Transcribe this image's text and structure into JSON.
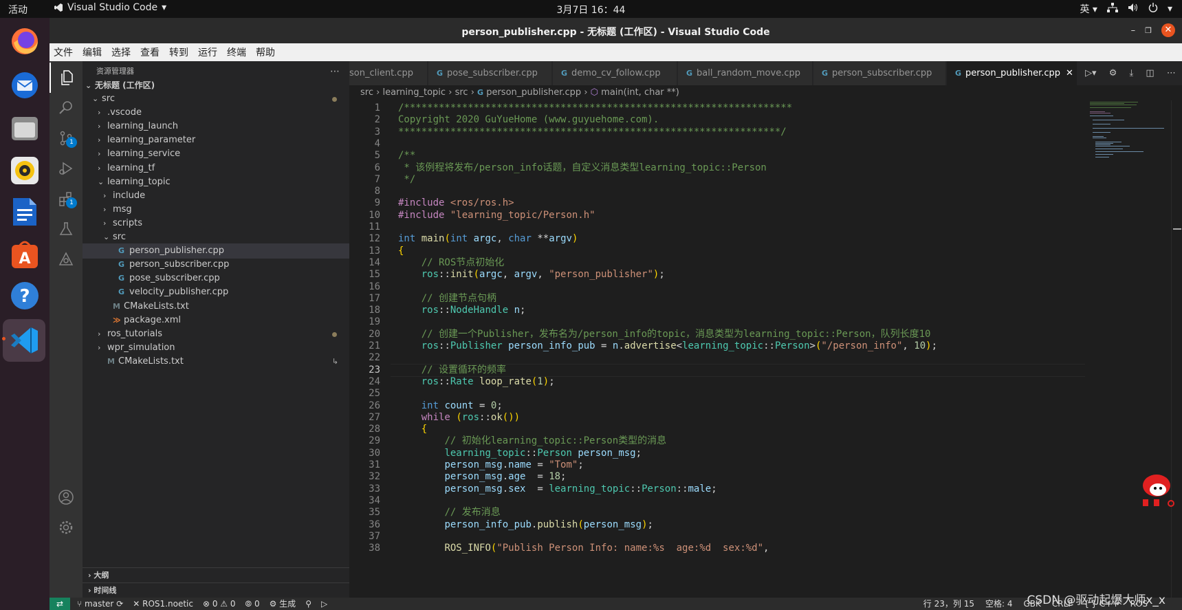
{
  "topbar": {
    "activities": "活动",
    "app_name": "Visual Studio Code",
    "clock": "3月7日  16：44",
    "ime": "英"
  },
  "window": {
    "title": "person_publisher.cpp - 无标题 (工作区) - Visual Studio Code"
  },
  "menubar": {
    "items": [
      "文件",
      "编辑",
      "选择",
      "查看",
      "转到",
      "运行",
      "终端",
      "帮助"
    ]
  },
  "activitybar": {
    "source_control_badge": "1",
    "extensions_badge": "1"
  },
  "sidebar": {
    "header": "资源管理器",
    "workspace": "无标题 (工作区)",
    "tree": [
      {
        "label": "src",
        "level": 0,
        "kind": "folder-open"
      },
      {
        "label": ".vscode",
        "level": 1,
        "kind": "folder"
      },
      {
        "label": "learning_launch",
        "level": 1,
        "kind": "folder"
      },
      {
        "label": "learning_parameter",
        "level": 1,
        "kind": "folder"
      },
      {
        "label": "learning_service",
        "level": 1,
        "kind": "folder"
      },
      {
        "label": "learning_tf",
        "level": 1,
        "kind": "folder"
      },
      {
        "label": "learning_topic",
        "level": 1,
        "kind": "folder-open"
      },
      {
        "label": "include",
        "level": 2,
        "kind": "folder"
      },
      {
        "label": "msg",
        "level": 2,
        "kind": "folder"
      },
      {
        "label": "scripts",
        "level": 2,
        "kind": "folder"
      },
      {
        "label": "src",
        "level": 2,
        "kind": "folder-open"
      },
      {
        "label": "person_publisher.cpp",
        "level": 3,
        "kind": "cpp",
        "selected": true
      },
      {
        "label": "person_subscriber.cpp",
        "level": 3,
        "kind": "cpp"
      },
      {
        "label": "pose_subscriber.cpp",
        "level": 3,
        "kind": "cpp"
      },
      {
        "label": "velocity_publisher.cpp",
        "level": 3,
        "kind": "cpp"
      },
      {
        "label": "CMakeLists.txt",
        "level": 2,
        "kind": "cmake"
      },
      {
        "label": "package.xml",
        "level": 2,
        "kind": "xml"
      },
      {
        "label": "ros_tutorials",
        "level": 1,
        "kind": "folder"
      },
      {
        "label": "wpr_simulation",
        "level": 1,
        "kind": "folder"
      },
      {
        "label": "CMakeLists.txt",
        "level": 1,
        "kind": "cmake-link"
      }
    ],
    "outline": "大纲",
    "timeline": "时间线"
  },
  "tabs": [
    {
      "label": "son_client.cpp",
      "active": false
    },
    {
      "label": "pose_subscriber.cpp",
      "active": false
    },
    {
      "label": "demo_cv_follow.cpp",
      "active": false
    },
    {
      "label": "ball_random_move.cpp",
      "active": false
    },
    {
      "label": "person_subscriber.cpp",
      "active": false
    },
    {
      "label": "person_publisher.cpp",
      "active": true
    }
  ],
  "breadcrumb": [
    "src",
    "learning_topic",
    "src",
    "person_publisher.cpp",
    "main(int, char **)"
  ],
  "editor": {
    "current_line": 23,
    "lines": [
      "/*******************************************************************",
      "Copyright 2020 GuYueHome (www.guyuehome.com).",
      "******************************************************************/",
      "",
      "/**",
      " * 该例程将发布/person_info话题，自定义消息类型learning_topic::Person",
      " */",
      "",
      "#include <ros/ros.h>",
      "#include \"learning_topic/Person.h\"",
      "",
      "int main(int argc, char **argv)",
      "{",
      "    // ROS节点初始化",
      "    ros::init(argc, argv, \"person_publisher\");",
      "",
      "    // 创建节点句柄",
      "    ros::NodeHandle n;",
      "",
      "    // 创建一个Publisher，发布名为/person_info的topic，消息类型为learning_topic::Person，队列长度10",
      "    ros::Publisher person_info_pub = n.advertise<learning_topic::Person>(\"/person_info\", 10);",
      "",
      "    // 设置循环的频率",
      "    ros::Rate loop_rate(1);",
      "",
      "    int count = 0;",
      "    while (ros::ok())",
      "    {",
      "        // 初始化learning_topic::Person类型的消息",
      "        learning_topic::Person person_msg;",
      "        person_msg.name = \"Tom\";",
      "        person_msg.age  = 18;",
      "        person_msg.sex  = learning_topic::Person::male;",
      "",
      "        // 发布消息",
      "        person_info_pub.publish(person_msg);",
      "",
      "        ROS_INFO(\"Publish Person Info: name:%s  age:%d  sex:%d\","
    ]
  },
  "statusbar": {
    "branch": "master",
    "env": "ROS1.noetic",
    "problems": "⊗ 0 ⚠ 0",
    "ports": "0",
    "build": "生成",
    "position": "行 23，列 15",
    "indent": "空格: 4",
    "encoding": "GBK",
    "eol": "CRLF",
    "language": "C++",
    "ros": "ROS"
  },
  "watermark": "CSDN @驱动起爆大师x_x"
}
